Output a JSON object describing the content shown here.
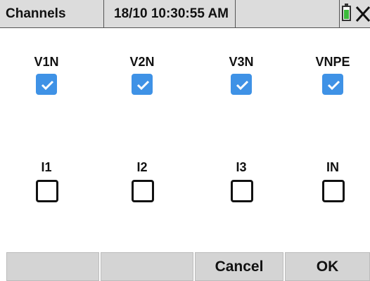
{
  "header": {
    "title": "Channels",
    "datetime": "18/10 10:30:55 AM",
    "battery_color": "#3cb93c"
  },
  "voltage_channels": [
    {
      "label": "V1N",
      "checked": true
    },
    {
      "label": "V2N",
      "checked": true
    },
    {
      "label": "V3N",
      "checked": true
    },
    {
      "label": "VNPE",
      "checked": true
    }
  ],
  "current_channels": [
    {
      "label": "I1",
      "checked": false
    },
    {
      "label": "I2",
      "checked": false
    },
    {
      "label": "I3",
      "checked": false
    },
    {
      "label": "IN",
      "checked": false
    }
  ],
  "footer": {
    "btn1_label": "",
    "btn2_label": "",
    "cancel_label": "Cancel",
    "ok_label": "OK"
  },
  "colors": {
    "checkbox_checked": "#3f92e6",
    "header_bg": "#dcdcdc",
    "button_bg": "#d4d4d4"
  }
}
